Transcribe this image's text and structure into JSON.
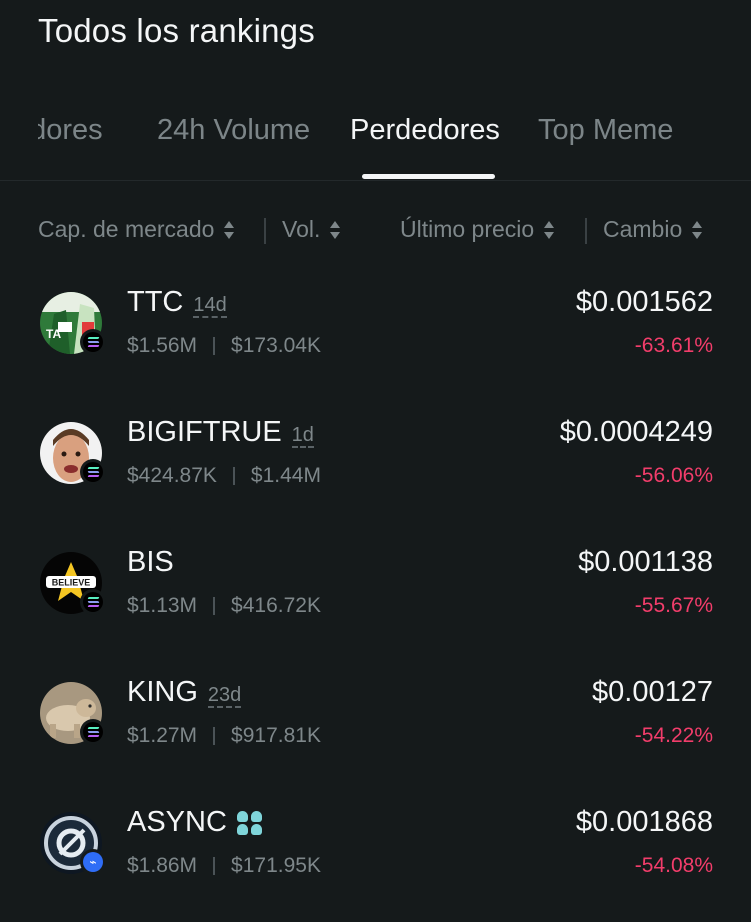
{
  "page": {
    "title": "Todos los rankings"
  },
  "tabs": [
    {
      "label": "ganadores",
      "visible_label": "adores",
      "active": false
    },
    {
      "label": "24h Volume",
      "active": false
    },
    {
      "label": "Perdedores",
      "active": true
    },
    {
      "label": "Top Meme",
      "active": false
    }
  ],
  "columns": {
    "market_cap": "Cap. de mercado",
    "volume": "Vol.",
    "last_price": "Último precio",
    "change": "Cambio"
  },
  "rows": [
    {
      "symbol": "TTC",
      "age": "14d",
      "market_cap": "$1.56M",
      "volume": "$173.04K",
      "price": "$0.001562",
      "change": "-63.61%",
      "chain_icon": "solana-icon",
      "avatar_icon": "ttc-token-avatar"
    },
    {
      "symbol": "BIGIFTRUE",
      "age": "1d",
      "market_cap": "$424.87K",
      "volume": "$1.44M",
      "price": "$0.0004249",
      "change": "-56.06%",
      "chain_icon": "solana-icon",
      "avatar_icon": "bigiftrue-token-avatar"
    },
    {
      "symbol": "BIS",
      "age": "",
      "market_cap": "$1.13M",
      "volume": "$416.72K",
      "price": "$0.001138",
      "change": "-55.67%",
      "chain_icon": "solana-icon",
      "avatar_icon": "bis-token-avatar",
      "avatar_text": "BELIEVE"
    },
    {
      "symbol": "KING",
      "age": "23d",
      "market_cap": "$1.27M",
      "volume": "$917.81K",
      "price": "$0.00127",
      "change": "-54.22%",
      "chain_icon": "solana-icon",
      "avatar_icon": "king-token-avatar"
    },
    {
      "symbol": "ASYNC",
      "age": "",
      "market_cap": "$1.86M",
      "volume": "$171.95K",
      "price": "$0.001868",
      "change": "-54.08%",
      "chain_icon": "base-icon",
      "avatar_icon": "async-token-avatar",
      "badge_icon": "team-icon"
    }
  ],
  "colors": {
    "background": "#151a1b",
    "negative": "#f23d6b",
    "muted": "#7e878a",
    "badge": "#7fd5da"
  }
}
